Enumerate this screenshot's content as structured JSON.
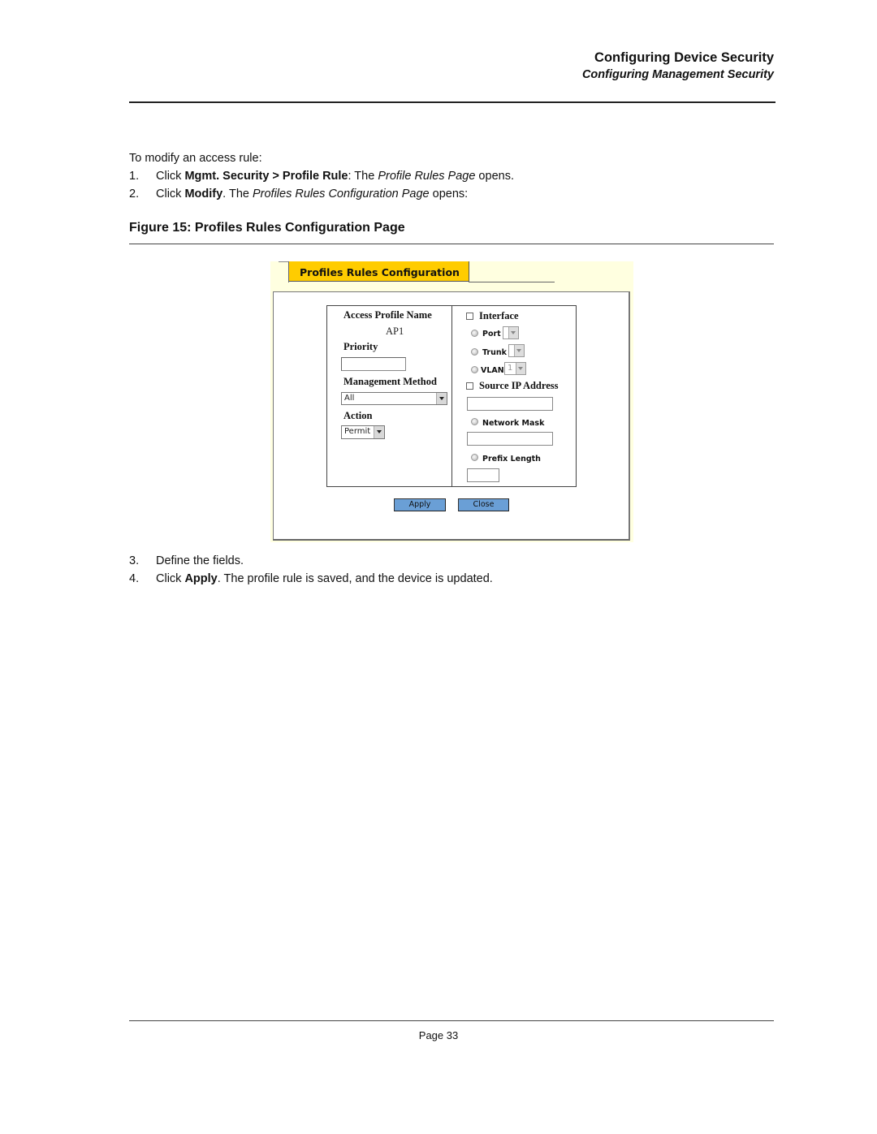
{
  "header": {
    "chapter_title": "Configuring Device Security",
    "section_title": "Configuring Management Security"
  },
  "body": {
    "intro": "To modify an access rule:",
    "steps": [
      {
        "num": "1.",
        "parts": [
          {
            "text": "Click ",
            "style": "normal"
          },
          {
            "text": "Mgmt. Security > Profile Rule",
            "style": "bold"
          },
          {
            "text": ": The ",
            "style": "normal"
          },
          {
            "text": "Profile Rules Page",
            "style": "italic"
          },
          {
            "text": " opens.",
            "style": "normal"
          }
        ]
      },
      {
        "num": "2.",
        "parts": [
          {
            "text": "Click ",
            "style": "normal"
          },
          {
            "text": "Modify",
            "style": "bold"
          },
          {
            "text": ". The ",
            "style": "normal"
          },
          {
            "text": "Profiles Rules Configuration Page",
            "style": "italic"
          },
          {
            "text": " opens:",
            "style": "normal"
          }
        ]
      },
      {
        "num": "3.",
        "parts": [
          {
            "text": "Define the fields.",
            "style": "normal"
          }
        ]
      },
      {
        "num": "4.",
        "parts": [
          {
            "text": "Click ",
            "style": "normal"
          },
          {
            "text": "Apply",
            "style": "bold"
          },
          {
            "text": ". The profile rule is saved, and the device is updated.",
            "style": "normal"
          }
        ]
      }
    ],
    "figure_caption": "Figure 15:  Profiles Rules Configuration Page"
  },
  "figure": {
    "tab_label": "Profiles Rules Configuration",
    "colors": {
      "tab": "#ffcc00",
      "background": "#ffffe0",
      "button": "#6a9fd6"
    },
    "left": {
      "access_profile_name_label": "Access Profile Name",
      "access_profile_name_value": "AP1",
      "priority_label": "Priority",
      "priority_value": "",
      "management_method_label": "Management Method",
      "management_method_value": "All",
      "action_label": "Action",
      "action_value": "Permit"
    },
    "right": {
      "interface_label": "Interface",
      "interface_checked": false,
      "port_label": "Port",
      "port_value": "",
      "trunk_label": "Trunk",
      "trunk_value": "",
      "vlan_label": "VLAN",
      "vlan_value": "1",
      "source_ip_label": "Source IP Address",
      "source_ip_checked": false,
      "source_ip_value": "",
      "network_mask_label": "Network Mask",
      "network_mask_value": "",
      "prefix_length_label": "Prefix Length",
      "prefix_length_value": ""
    },
    "buttons": {
      "apply": "Apply",
      "close": "Close"
    }
  },
  "footer": {
    "page_label": "Page 33"
  }
}
